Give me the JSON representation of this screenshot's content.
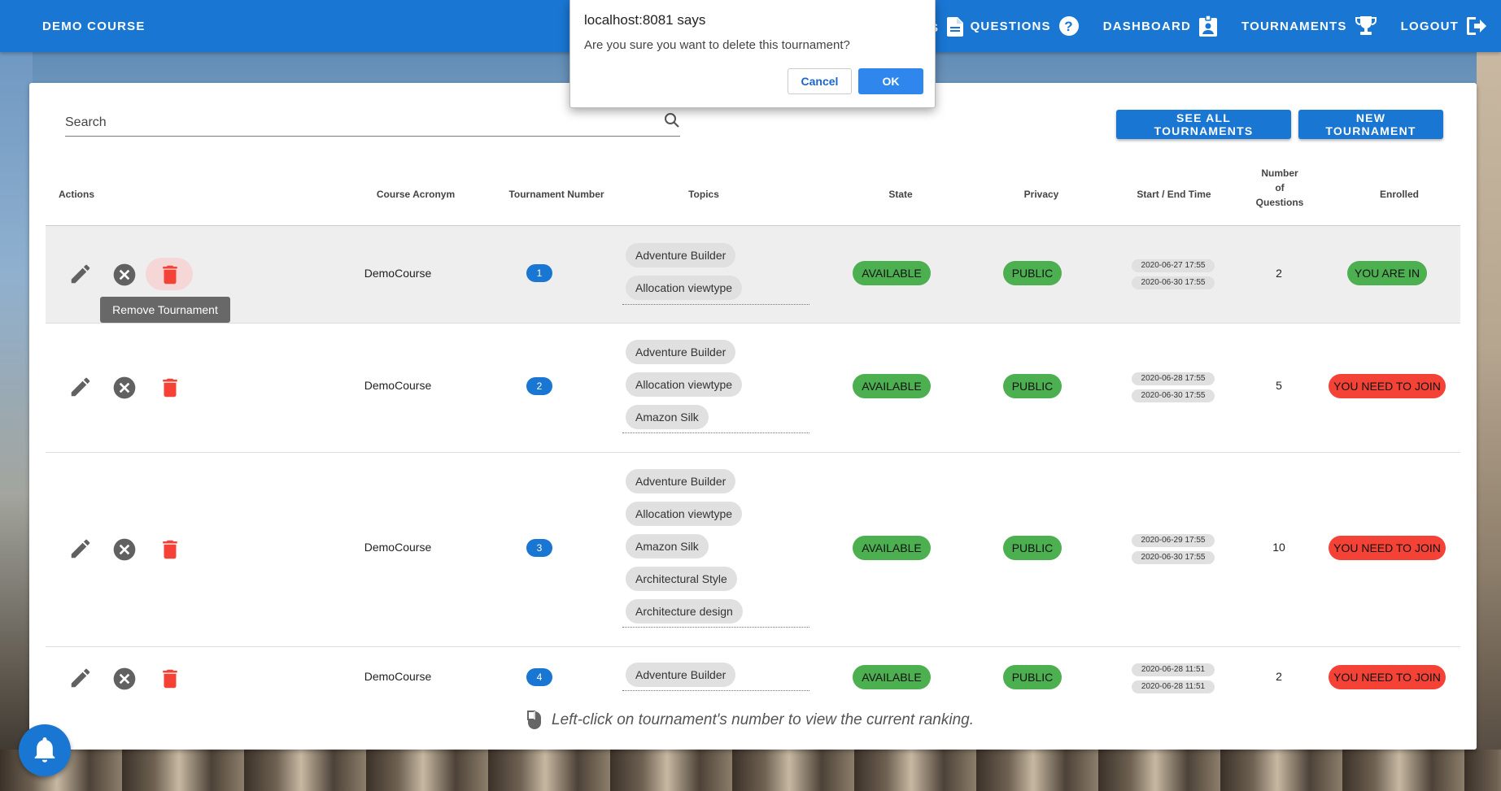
{
  "app": {
    "brand": "DEMO COURSE",
    "nav": {
      "partial_label": "S",
      "questions": "QUESTIONS",
      "dashboard": "DASHBOARD",
      "tournaments": "TOURNAMENTS",
      "logout": "LOGOUT"
    }
  },
  "search": {
    "placeholder": "Search",
    "value": ""
  },
  "buttons": {
    "see_all": "SEE ALL TOURNAMENTS",
    "new": "NEW TOURNAMENT"
  },
  "table": {
    "headers": {
      "actions": "Actions",
      "acronym": "Course Acronym",
      "number": "Tournament Number",
      "topics": "Topics",
      "state": "State",
      "privacy": "Privacy",
      "time": "Start / End Time",
      "questions_line1": "Number",
      "questions_line2": "of",
      "questions_line3": "Questions",
      "enrolled": "Enrolled"
    },
    "rows": [
      {
        "acronym": "DemoCourse",
        "number": "1",
        "topics": [
          "Adventure Builder",
          "Allocation viewtype"
        ],
        "state": "AVAILABLE",
        "privacy": "PUBLIC",
        "start": "2020-06-27 17:55",
        "end": "2020-06-30 17:55",
        "questions": "2",
        "enrolled": "YOU ARE IN"
      },
      {
        "acronym": "DemoCourse",
        "number": "2",
        "topics": [
          "Adventure Builder",
          "Allocation viewtype",
          "Amazon Silk"
        ],
        "state": "AVAILABLE",
        "privacy": "PUBLIC",
        "start": "2020-06-28 17:55",
        "end": "2020-06-30 17:55",
        "questions": "5",
        "enrolled": "YOU NEED TO JOIN"
      },
      {
        "acronym": "DemoCourse",
        "number": "3",
        "topics": [
          "Adventure Builder",
          "Allocation viewtype",
          "Amazon Silk",
          "Architectural Style",
          "Architecture design"
        ],
        "state": "AVAILABLE",
        "privacy": "PUBLIC",
        "start": "2020-06-29 17:55",
        "end": "2020-06-30 17:55",
        "questions": "10",
        "enrolled": "YOU NEED TO JOIN"
      },
      {
        "acronym": "DemoCourse",
        "number": "4",
        "topics": [
          "Adventure Builder"
        ],
        "state": "AVAILABLE",
        "privacy": "PUBLIC",
        "start": "2020-06-28 11:51",
        "end": "2020-06-28 11:51",
        "questions": "2",
        "enrolled": "YOU NEED TO JOIN"
      }
    ]
  },
  "tooltip": "Remove Tournament",
  "footer_note": "Left-click on tournament's number to view the current ranking.",
  "dialog": {
    "title": "localhost:8081 says",
    "message": "Are you sure you want to delete this tournament?",
    "cancel": "Cancel",
    "ok": "OK"
  },
  "colors": {
    "primary": "#1976d2",
    "success": "#4caf50",
    "error": "#f44336",
    "icon_grey": "#616161"
  }
}
